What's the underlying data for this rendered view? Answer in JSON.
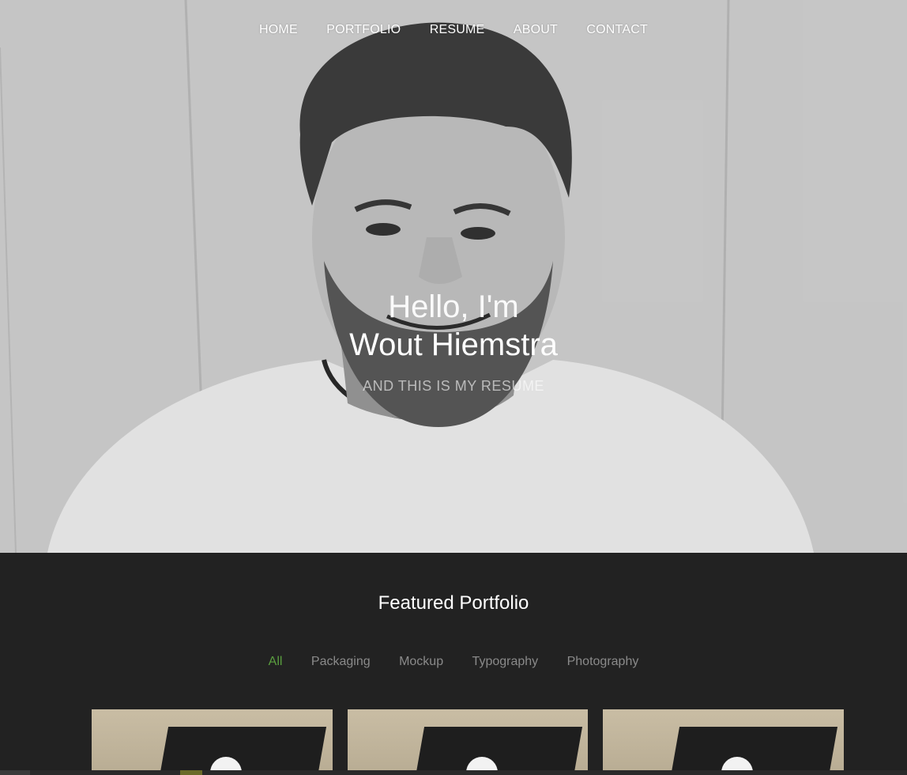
{
  "nav": {
    "items": [
      "HOME",
      "PORTFOLIO",
      "RESUME",
      "ABOUT",
      "CONTACT"
    ]
  },
  "hero": {
    "greeting": "Hello, I'm",
    "name": "Wout Hiemstra",
    "tagline": "AND THIS IS MY RESUME"
  },
  "portfolio": {
    "title_light": "Featured",
    "title_strong": "Portfolio",
    "filters": [
      "All",
      "Packaging",
      "Mockup",
      "Typography",
      "Photography"
    ],
    "active_filter": "All"
  },
  "colors": {
    "accent": "#5a9e3f",
    "section_bg": "#222222"
  }
}
